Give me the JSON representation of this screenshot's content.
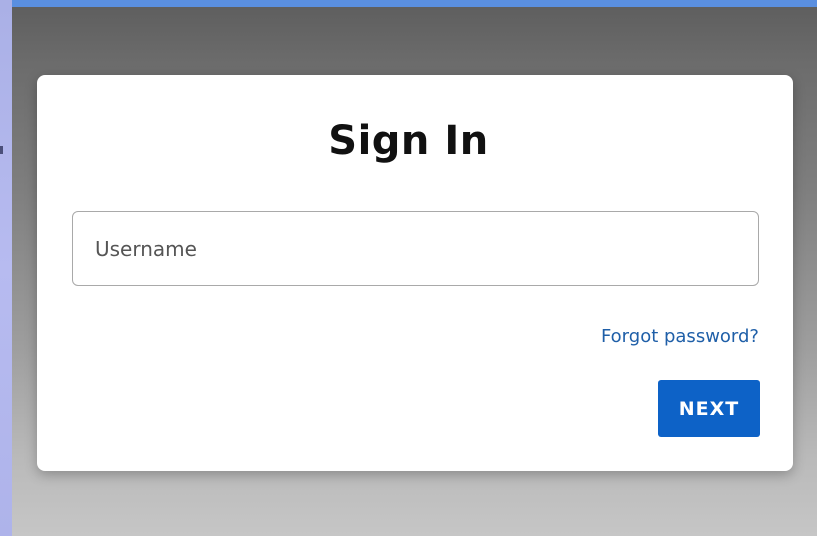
{
  "colors": {
    "accent": "#0d62c7",
    "link": "#1f5fa8",
    "backdrop": "#7e7e7e",
    "card": "#ffffff"
  },
  "signin": {
    "title": "Sign In",
    "username_placeholder": "Username",
    "username_value": "",
    "forgot_label": "Forgot password?",
    "next_label": "NEXT"
  }
}
